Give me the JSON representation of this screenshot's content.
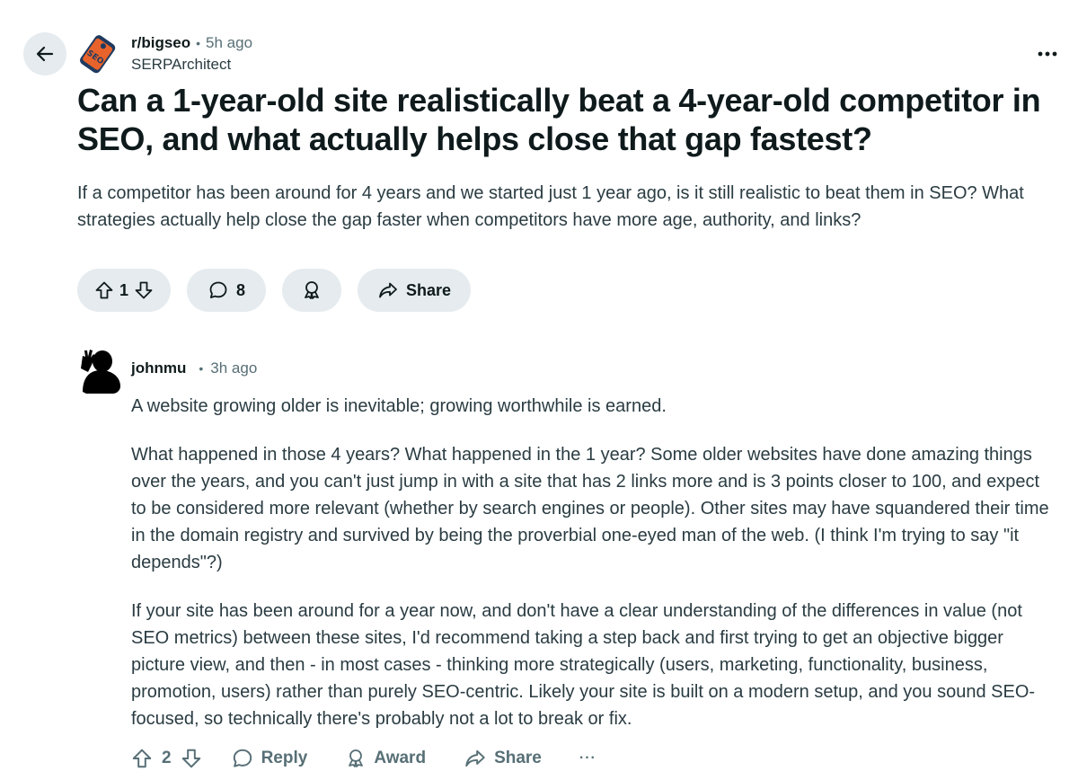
{
  "post": {
    "subreddit": "r/bigseo",
    "separator": "•",
    "time": "5h ago",
    "author": "SERPArchitect",
    "subreddit_icon_text": "SEO",
    "title": "Can a 1-year-old site realistically beat a 4-year-old competitor in SEO, and what actually helps close that gap fastest?",
    "body": [
      "If a competitor has been around for 4 years and we started just 1 year ago, is it still realistic to beat them in SEO? What strategies actually help close the gap faster when competitors have more age, authority, and links?"
    ],
    "votes": "1",
    "comments": "8",
    "share_label": "Share"
  },
  "comment": {
    "author": "johnmu",
    "separator": "•",
    "time": "3h ago",
    "paragraphs": [
      "A website growing older is inevitable; growing worthwhile is earned.",
      "What happened in those 4 years? What happened in the 1 year? Some older websites have done amazing things over the years, and you can't just jump in with a site that has 2 links more and is 3 points closer to 100, and expect to be considered more relevant (whether by search engines or people). Other sites may have squandered their time in the domain registry and survived by being the proverbial one-eyed man of the web. (I think I'm trying to say \"it depends\"?)",
      "If your site has been around for a year now, and don't have a clear understanding of the differences in value (not SEO metrics) between these sites, I'd recommend taking a step back and first trying to get an objective bigger picture view, and then - in most cases - thinking more strategically (users, marketing, functionality, business, promotion, users) rather than purely SEO-centric. Likely your site is built on a modern setup, and you sound SEO-focused, so technically there's probably not a lot to break or fix."
    ],
    "votes": "2",
    "reply_label": "Reply",
    "award_label": "Award",
    "share_label": "Share",
    "more_label": "···"
  },
  "colors": {
    "pill_bg": "#e5ebee",
    "text_primary": "#0f1a1c",
    "text_secondary": "#576f76",
    "subreddit_icon_bg": "#1f3a5f",
    "subreddit_icon_accent": "#e8632b"
  },
  "icons": {
    "back": "arrow-left-icon",
    "more": "ellipsis-icon",
    "upvote": "arrow-up-outline-icon",
    "downvote": "arrow-down-outline-icon",
    "comment": "speech-bubble-icon",
    "award": "award-ribbon-icon",
    "share": "share-arrow-icon",
    "reply": "speech-bubble-icon"
  }
}
